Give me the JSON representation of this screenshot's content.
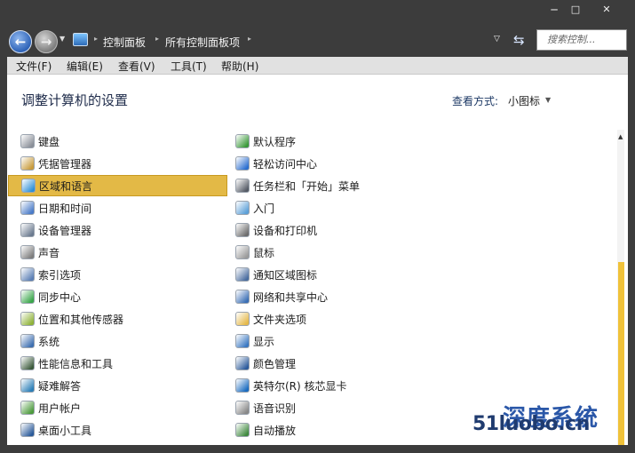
{
  "window": {
    "minimize_glyph": "─",
    "maximize_glyph": "□",
    "close_glyph": "✕"
  },
  "nav": {
    "breadcrumb": [
      "控制面板",
      "所有控制面板项"
    ],
    "search_placeholder": "搜索控制..."
  },
  "menu": [
    "文件(F)",
    "编辑(E)",
    "查看(V)",
    "工具(T)",
    "帮助(H)"
  ],
  "page": {
    "title": "调整计算机的设置",
    "view_label": "查看方式:",
    "view_value": "小图标"
  },
  "items_left": [
    {
      "label": "键盘",
      "icon": "keyboard-icon"
    },
    {
      "label": "凭据管理器",
      "icon": "credential-manager-icon"
    },
    {
      "label": "区域和语言",
      "icon": "globe-icon",
      "selected": true
    },
    {
      "label": "日期和时间",
      "icon": "calendar-clock-icon"
    },
    {
      "label": "设备管理器",
      "icon": "device-manager-icon"
    },
    {
      "label": "声音",
      "icon": "speaker-icon"
    },
    {
      "label": "索引选项",
      "icon": "index-options-icon"
    },
    {
      "label": "同步中心",
      "icon": "sync-icon"
    },
    {
      "label": "位置和其他传感器",
      "icon": "sensor-icon"
    },
    {
      "label": "系统",
      "icon": "system-icon"
    },
    {
      "label": "性能信息和工具",
      "icon": "performance-icon"
    },
    {
      "label": "疑难解答",
      "icon": "troubleshoot-icon"
    },
    {
      "label": "用户帐户",
      "icon": "user-accounts-icon"
    },
    {
      "label": "桌面小工具",
      "icon": "gadgets-icon"
    }
  ],
  "items_right": [
    {
      "label": "默认程序",
      "icon": "default-programs-icon"
    },
    {
      "label": "轻松访问中心",
      "icon": "ease-of-access-icon"
    },
    {
      "label": "任务栏和「开始」菜单",
      "icon": "taskbar-icon"
    },
    {
      "label": "入门",
      "icon": "getting-started-icon"
    },
    {
      "label": "设备和打印机",
      "icon": "printer-icon"
    },
    {
      "label": "鼠标",
      "icon": "mouse-icon"
    },
    {
      "label": "通知区域图标",
      "icon": "notification-icon"
    },
    {
      "label": "网络和共享中心",
      "icon": "network-icon"
    },
    {
      "label": "文件夹选项",
      "icon": "folder-options-icon"
    },
    {
      "label": "显示",
      "icon": "display-icon"
    },
    {
      "label": "颜色管理",
      "icon": "color-management-icon"
    },
    {
      "label": "英特尔(R) 核芯显卡",
      "icon": "intel-graphics-icon"
    },
    {
      "label": "语音识别",
      "icon": "microphone-icon"
    },
    {
      "label": "自动播放",
      "icon": "autoplay-icon"
    }
  ],
  "watermark": {
    "brand_cn": "深度系统",
    "brand_url": "51luobo.cn"
  },
  "colors": {
    "selection": "#e3b946",
    "chrome": "#3c3c3c",
    "menubar": "#e1e1e1",
    "scroll_thumb": "#f0c23a"
  }
}
